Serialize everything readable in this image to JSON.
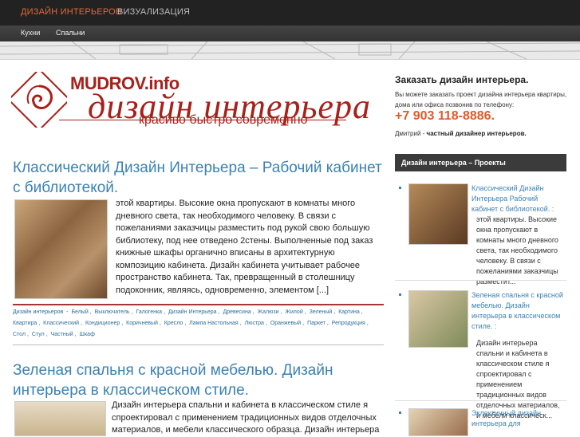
{
  "topnav": {
    "items": [
      {
        "label": "ДИЗАЙН ИНТЕРЬЕРОВ"
      },
      {
        "label": "ВИЗУАЛИЗАЦИЯ"
      }
    ]
  },
  "subnav": {
    "items": [
      {
        "label": "Кухни"
      },
      {
        "label": "Спальни"
      }
    ]
  },
  "logo": {
    "site": "MUDROV.info",
    "script": "дизайн интерьера",
    "tagline": "красиво быстро современно"
  },
  "posts": [
    {
      "title": "Классический Дизайн Интерьера – Рабочий кабинет с библиотекой.",
      "excerpt": "этой квартиры. Высокие окна пропускают в комнаты много дневного света, так необходимого человеку. В связи с пожеланиями заказчицы разместить под рукой свою большую библиотеку, под нее отведено 2стены. Выполненные под заказ книжные шкафы органично вписаны в архитектурную композицию кабинета. Дизайн кабинета учитывает рабочее пространство кабинета. Так, превращенный в столешницу подоконник, являясь, одновременно, элементом [...]",
      "tags": [
        "Дизайн интерьеров",
        "Белый",
        "Выключатель",
        "Галогенка",
        "Дизайн Интерьера",
        "Древесина",
        "Жалюзи",
        "Жилой",
        "Зеленый",
        "Картина",
        "Квартира",
        "Классический",
        "Кондиционер",
        "Коричневый",
        "Кресло",
        "Лампа Настольная",
        "Люстра",
        "Оранжевый",
        "Паркет",
        "Репродукция",
        "Стол",
        "Стул",
        "Частный",
        "Шкаф"
      ]
    },
    {
      "title": "Зеленая спальня с красной мебелью. Дизайн интерьера в классическом стиле.",
      "excerpt": "Дизайн интерьера спальни и кабинета в классическом стиле я спроектировал с применением традиционных видов отделочных материалов, и мебели классического образца. Дизайн интерьера"
    }
  ],
  "sidebar": {
    "heading": "Заказать дизайн интерьера.",
    "text": "Вы можете заказать проект дизайна интерьера квартиры, дома или офиса позвонив по телефону:",
    "phone": "+7 903 118-8886.",
    "author_prefix": "Дмитрий - ",
    "author_bold": "частный дизайнер интерьеров.",
    "projects_bar": "Дизайн интерьера – Проекты",
    "projects": [
      {
        "title": "Классический Дизайн Интерьера Рабочий кабинет с библиотекой. :",
        "body": "этой квартиры. Высокие окна пропускают в комнаты много дневного света, так необходимого человеку. В связи с пожеланиями заказчицы разместит..."
      },
      {
        "title": "Зеленая спальня с красной мебелью. Дизайн интерьера в классическом стиле. :",
        "body": "Дизайн интерьера спальни и кабинета в классическом стиле я спроектировал с применением традиционных видов отделочных материалов, и мебели классическ..."
      },
      {
        "title": "Эклектичный дизайн интерьера для"
      }
    ]
  },
  "colors": {
    "accent_orange": "#e06a3a",
    "link_blue": "#3a82b5",
    "brand_red": "#a8201a",
    "nav_dark": "#222222"
  }
}
